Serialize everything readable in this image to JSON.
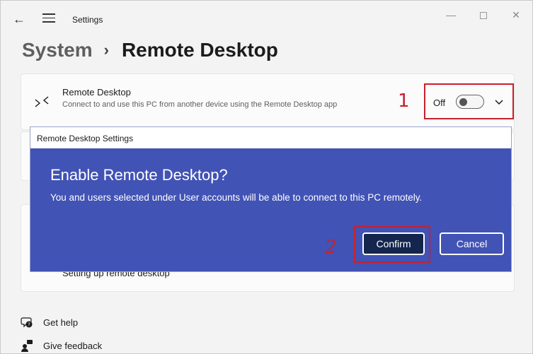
{
  "window": {
    "title": "Settings",
    "controls": {
      "minimize": "—",
      "close": "✕"
    }
  },
  "breadcrumb": {
    "parent": "System",
    "separator": "›",
    "current": "Remote Desktop"
  },
  "remote_desktop": {
    "title": "Remote Desktop",
    "description": "Connect to and use this PC from another device using the Remote Desktop app",
    "toggle_state": "Off",
    "toggle_value": 0
  },
  "setup_link": "Setting up remote desktop",
  "annotations": {
    "step1": "1",
    "step2": "2",
    "color": "#c8202e"
  },
  "dialog": {
    "caption": "Remote Desktop Settings",
    "heading": "Enable Remote Desktop?",
    "message": "You and users selected under User accounts will be able to connect to this PC remotely.",
    "confirm_label": "Confirm",
    "cancel_label": "Cancel",
    "background_color": "#4153b5"
  },
  "footer": {
    "help": "Get help",
    "feedback": "Give feedback"
  }
}
